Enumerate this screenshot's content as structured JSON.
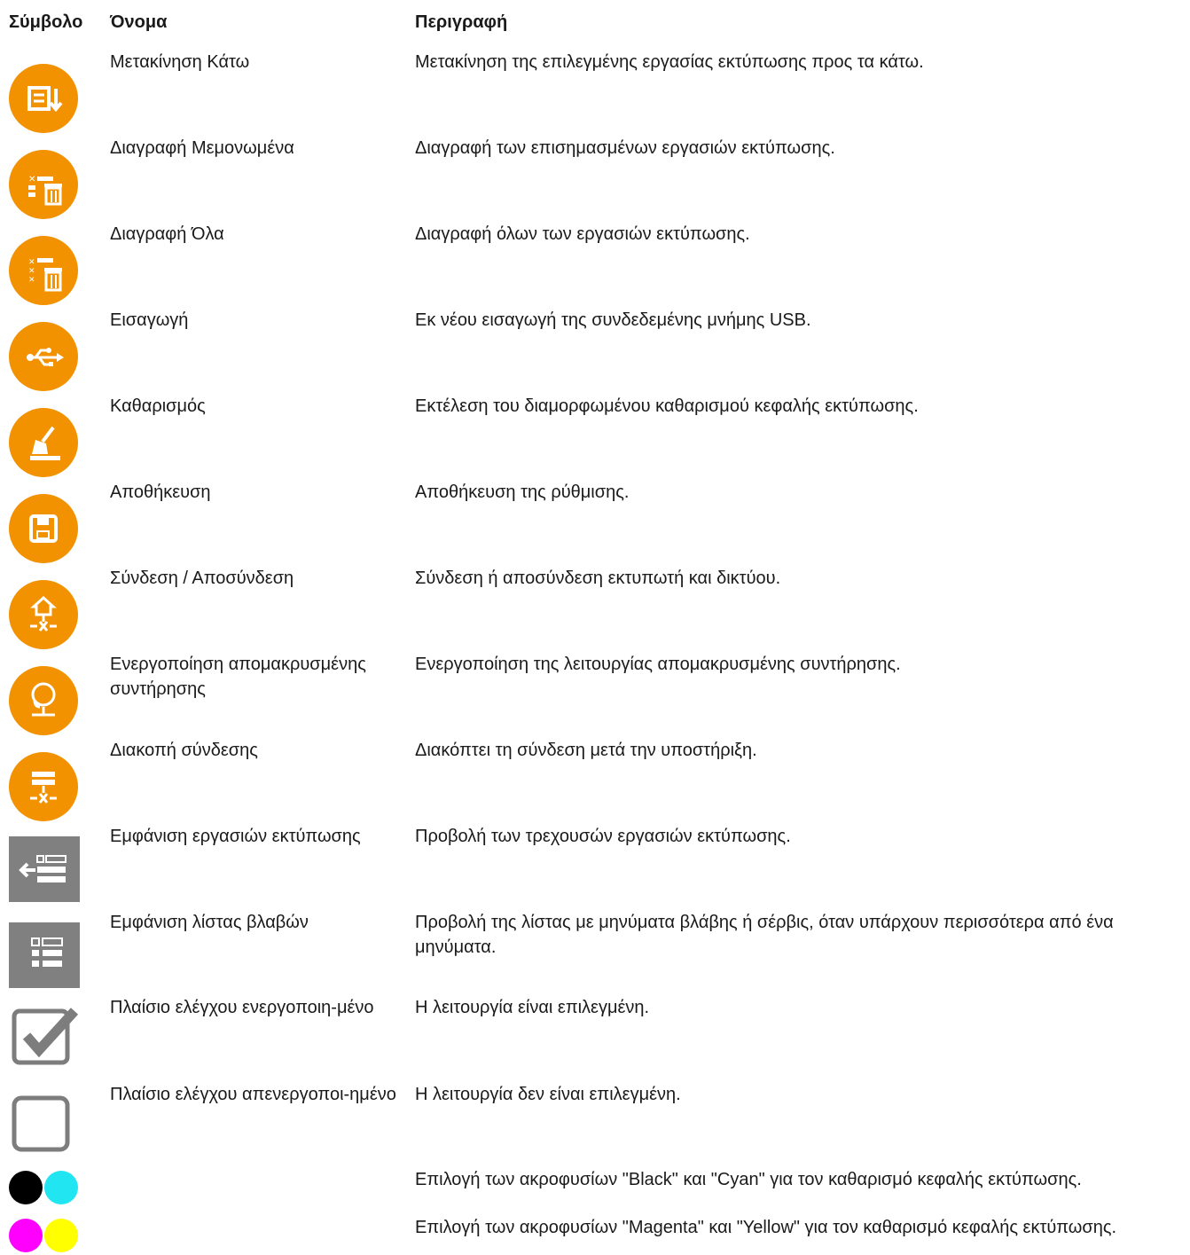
{
  "header": {
    "symbol": "Σύμβολο",
    "name": "Όνομα",
    "description": "Περιγραφή"
  },
  "rows": [
    {
      "icon": "move-down-icon",
      "name": "Μετακίνηση Κάτω",
      "description": "Μετακίνηση της επιλεγμένης εργασίας εκτύπωσης προς τα κάτω."
    },
    {
      "icon": "delete-selected-icon",
      "name": "Διαγραφή Μεμονωμένα",
      "description": "Διαγραφή των επισημασμένων εργασιών εκτύπωσης."
    },
    {
      "icon": "delete-all-icon",
      "name": "Διαγραφή Όλα",
      "description": "Διαγραφή όλων των εργασιών εκτύπωσης."
    },
    {
      "icon": "usb-icon",
      "name": "Εισαγωγή",
      "description": "Εκ νέου εισαγωγή της συνδεδεμένης μνήμης USB."
    },
    {
      "icon": "cleaning-icon",
      "name": "Καθαρισμός",
      "description": "Εκτέλεση του διαμορφωμένου καθαρισμού κεφαλής εκτύπωσης."
    },
    {
      "icon": "save-icon",
      "name": "Αποθήκευση",
      "description": "Αποθήκευση της ρύθμισης."
    },
    {
      "icon": "network-connect-icon",
      "name": "Σύνδεση / Αποσύνδεση",
      "description": "Σύνδεση ή αποσύνδεση εκτυπωτή και δικτύου."
    },
    {
      "icon": "remote-maintenance-icon",
      "name": "Ενεργοποίηση απομακρυσμένης συντήρησης",
      "description": "Ενεργοποίηση της λειτουργίας απομακρυσμένης συντήρησης."
    },
    {
      "icon": "disconnect-icon",
      "name": "Διακοπή σύνδεσης",
      "description": "Διακόπτει τη σύνδεση μετά την υποστήριξη."
    },
    {
      "icon": "show-print-jobs-icon",
      "name": "Εμφάνιση εργασιών εκτύπωσης",
      "description": "Προβολή των τρεχουσών εργασιών εκτύπωσης."
    },
    {
      "icon": "show-error-list-icon",
      "name": "Εμφάνιση λίστας βλαβών",
      "description": "Προβολή της λίστας με μηνύματα βλάβης ή σέρβις, όταν υπάρχουν περισσότερα από ένα μηνύματα."
    },
    {
      "icon": "checkbox-checked-icon",
      "name": "Πλαίσιο ελέγχου ενεργοποιη-μένο",
      "description": "Η λειτουργία είναι επιλεγμένη."
    },
    {
      "icon": "checkbox-unchecked-icon",
      "name": "Πλαίσιο ελέγχου απενεργοποι-ημένο",
      "description": "Η λειτουργία δεν είναι επιλεγμένη."
    },
    {
      "icon": "black-cyan-nozzles-icon",
      "name": "",
      "description": "Επιλογή των ακροφυσίων \"Black\" και \"Cyan\" για τον καθαρισμό κεφαλής εκτύπωσης."
    },
    {
      "icon": "magenta-yellow-nozzles-icon",
      "name": "",
      "description": "Επιλογή των ακροφυσίων \"Magenta\" και \"Yellow\" για τον καθαρισμό κεφαλής εκτύπωσης."
    }
  ],
  "colors": {
    "accent": "#f39200",
    "gray_icon": "#808080",
    "black": "#000000",
    "cyan": "#22e5f2",
    "magenta": "#ff00ff",
    "yellow": "#ffff00"
  }
}
